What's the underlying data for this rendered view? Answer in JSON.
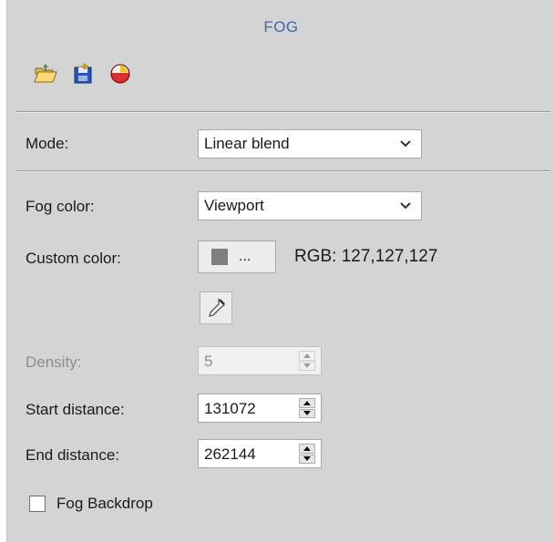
{
  "panel": {
    "title": "FOG",
    "toolbar": [
      {
        "icon": "open-folder-icon"
      },
      {
        "icon": "save-disk-icon"
      },
      {
        "icon": "color-ball-icon"
      }
    ]
  },
  "mode": {
    "label": "Mode:",
    "value": "Linear blend"
  },
  "fog_color": {
    "label": "Fog color:",
    "value": "Viewport"
  },
  "custom_color": {
    "label": "Custom color:",
    "button_text": "...",
    "swatch_color": "#7f7f7f",
    "rgb_text": "RGB: 127,127,127"
  },
  "eyedropper": {
    "icon": "eyedropper-icon"
  },
  "density": {
    "label": "Density:",
    "value": "5",
    "disabled": true
  },
  "start_distance": {
    "label": "Start distance:",
    "value": "131072"
  },
  "end_distance": {
    "label": "End distance:",
    "value": "262144"
  },
  "fog_backdrop": {
    "label": "Fog Backdrop",
    "checked": false
  },
  "colors": {
    "panel_bg": "#d4d4d4",
    "title": "#3a6aa8",
    "disabled_text": "#8d8d8d"
  }
}
